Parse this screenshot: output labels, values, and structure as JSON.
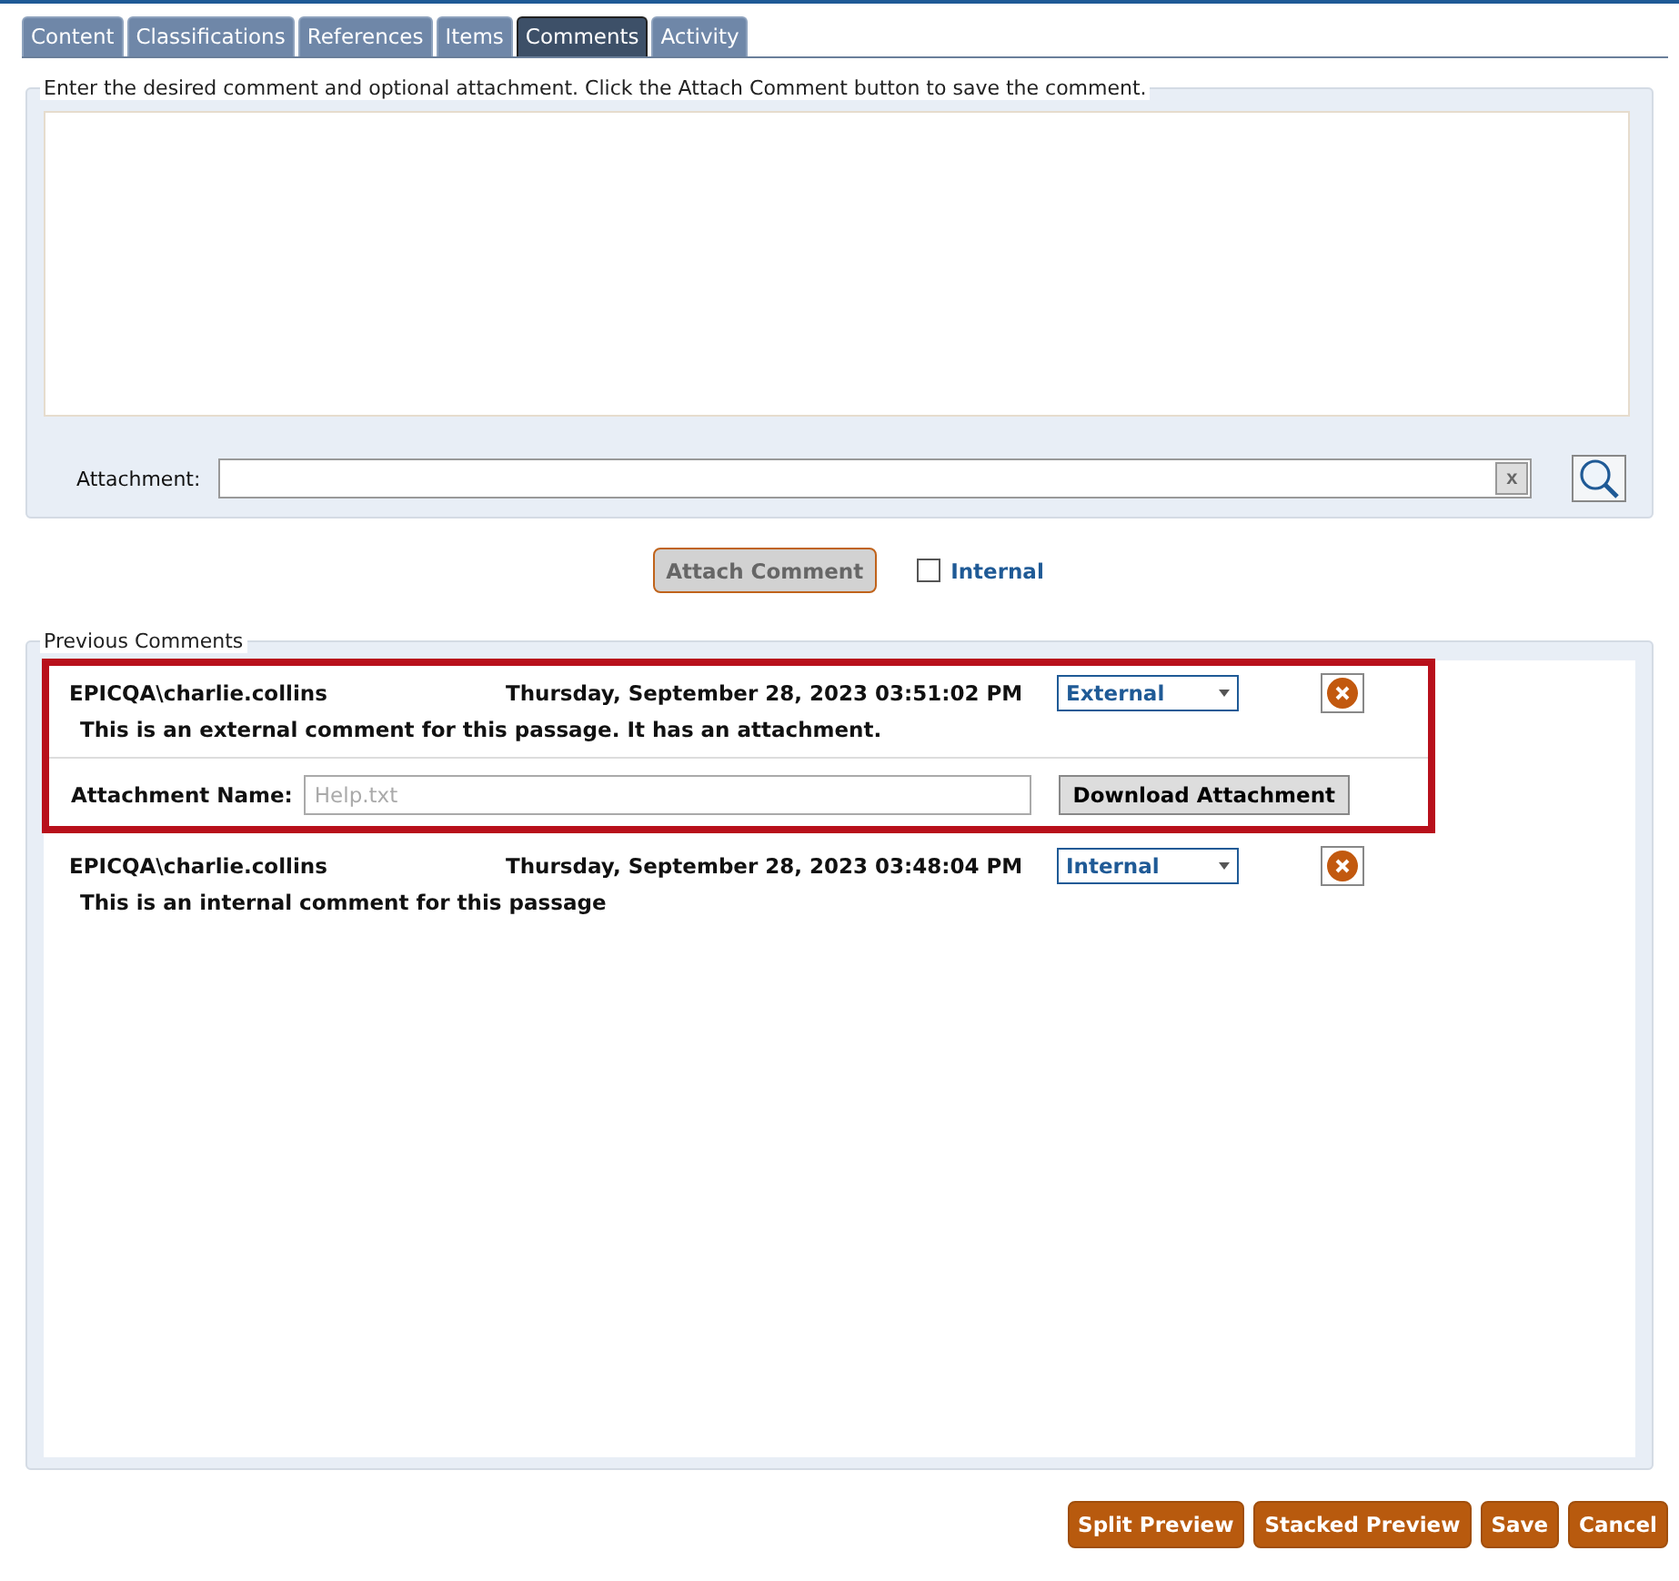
{
  "tabs": [
    {
      "label": "Content",
      "selected": false
    },
    {
      "label": "Classifications",
      "selected": false
    },
    {
      "label": "References",
      "selected": false
    },
    {
      "label": "Items",
      "selected": false
    },
    {
      "label": "Comments",
      "selected": true
    },
    {
      "label": "Activity",
      "selected": false
    }
  ],
  "new_comment": {
    "legend": "Enter the desired comment and optional attachment. Click the Attach Comment button to save the comment.",
    "attachment_label": "Attachment:",
    "clear_button": "x"
  },
  "attach_button": "Attach Comment",
  "internal_checkbox": {
    "label": "Internal",
    "checked": false
  },
  "previous_comments": {
    "legend": "Previous Comments",
    "comments": [
      {
        "user": "EPICQA\\charlie.collins",
        "date": "Thursday, September 28, 2023 03:51:02 PM",
        "visibility": "External",
        "text": "This is an external comment for this passage.  It has an attachment.",
        "highlighted": true,
        "attachment": {
          "label": "Attachment Name:",
          "name": "Help.txt",
          "button": "Download Attachment"
        }
      },
      {
        "user": "EPICQA\\charlie.collins",
        "date": "Thursday, September 28, 2023 03:48:04 PM",
        "visibility": "Internal",
        "text": "This is an internal comment for this passage",
        "highlighted": false
      }
    ]
  },
  "footer_buttons": [
    "Split Preview",
    "Stacked Preview",
    "Save",
    "Cancel"
  ]
}
